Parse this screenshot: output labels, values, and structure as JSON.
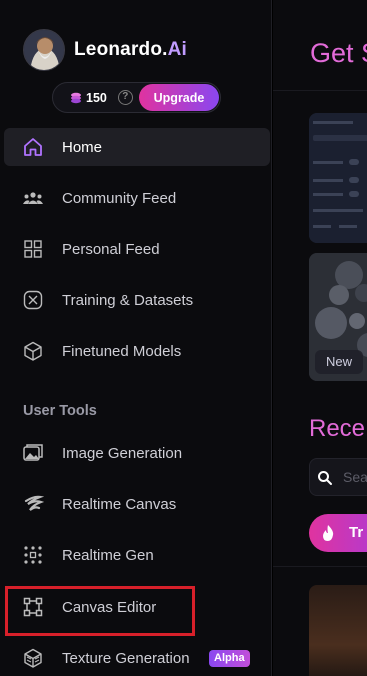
{
  "brand": {
    "name": "Leonardo.",
    "suffix": "Ai"
  },
  "credits": {
    "count": "150",
    "help": "?",
    "upgrade_label": "Upgrade"
  },
  "nav": {
    "home": "Home",
    "community_feed": "Community Feed",
    "personal_feed": "Personal Feed",
    "training": "Training & Datasets",
    "finetuned": "Finetuned Models"
  },
  "user_tools": {
    "title": "User Tools",
    "image_generation": "Image Generation",
    "realtime_canvas": "Realtime Canvas",
    "realtime_gen": "Realtime Gen",
    "canvas_editor": "Canvas Editor",
    "texture_generation": "Texture Generation",
    "alpha_badge": "Alpha"
  },
  "main": {
    "headline": "Get S",
    "new_badge": "New",
    "recent_title": "Rece",
    "search_placeholder": "Sea",
    "trending_label": "Tr"
  },
  "colors": {
    "accent_pink": "#e26bd8",
    "gradient_start": "#e0339f",
    "gradient_end": "#8a47f0",
    "highlight_red": "#d8202a"
  }
}
